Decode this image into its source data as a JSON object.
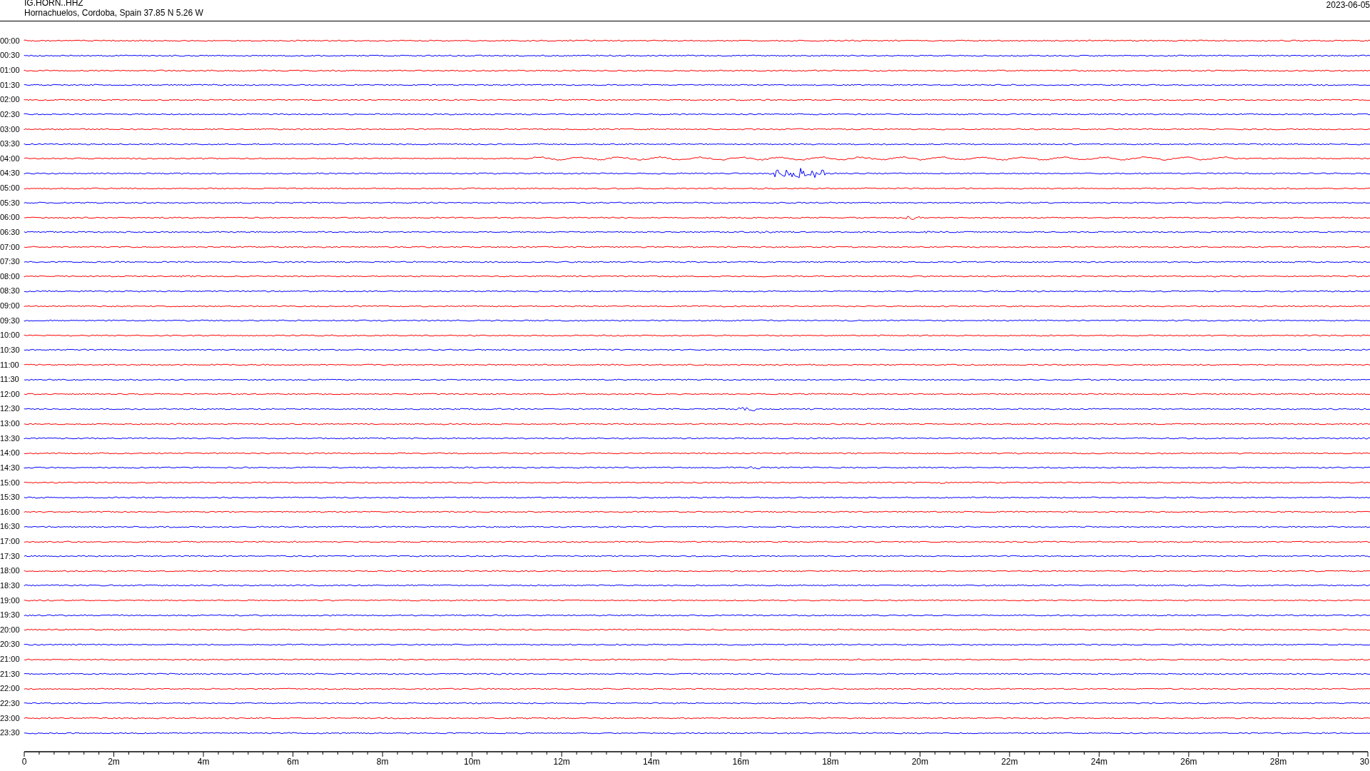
{
  "header": {
    "station": "IG.HORN..HHZ",
    "location": "Hornachuelos, Cordoba, Spain  37.85 N 5.26 W",
    "date": "2023-06-05"
  },
  "rows": [
    {
      "label": "00:00",
      "color": "#ff0000"
    },
    {
      "label": "00:30",
      "color": "#0000ff"
    },
    {
      "label": "01:00",
      "color": "#ff0000"
    },
    {
      "label": "01:30",
      "color": "#0000ff"
    },
    {
      "label": "02:00",
      "color": "#ff0000"
    },
    {
      "label": "02:30",
      "color": "#0000ff"
    },
    {
      "label": "03:00",
      "color": "#ff0000"
    },
    {
      "label": "03:30",
      "color": "#0000ff"
    },
    {
      "label": "04:00",
      "color": "#ff0000"
    },
    {
      "label": "04:30",
      "color": "#0000ff"
    },
    {
      "label": "05:00",
      "color": "#ff0000"
    },
    {
      "label": "05:30",
      "color": "#0000ff"
    },
    {
      "label": "06:00",
      "color": "#ff0000"
    },
    {
      "label": "06:30",
      "color": "#0000ff"
    },
    {
      "label": "07:00",
      "color": "#ff0000"
    },
    {
      "label": "07:30",
      "color": "#0000ff"
    },
    {
      "label": "08:00",
      "color": "#ff0000"
    },
    {
      "label": "08:30",
      "color": "#0000ff"
    },
    {
      "label": "09:00",
      "color": "#ff0000"
    },
    {
      "label": "09:30",
      "color": "#0000ff"
    },
    {
      "label": "10:00",
      "color": "#ff0000"
    },
    {
      "label": "10:30",
      "color": "#0000ff"
    },
    {
      "label": "11:00",
      "color": "#ff0000"
    },
    {
      "label": "11:30",
      "color": "#0000ff"
    },
    {
      "label": "12:00",
      "color": "#ff0000"
    },
    {
      "label": "12:30",
      "color": "#0000ff"
    },
    {
      "label": "13:00",
      "color": "#ff0000"
    },
    {
      "label": "13:30",
      "color": "#0000ff"
    },
    {
      "label": "14:00",
      "color": "#ff0000"
    },
    {
      "label": "14:30",
      "color": "#0000ff"
    },
    {
      "label": "15:00",
      "color": "#ff0000"
    },
    {
      "label": "15:30",
      "color": "#0000ff"
    },
    {
      "label": "16:00",
      "color": "#ff0000"
    },
    {
      "label": "16:30",
      "color": "#0000ff"
    },
    {
      "label": "17:00",
      "color": "#ff0000"
    },
    {
      "label": "17:30",
      "color": "#0000ff"
    },
    {
      "label": "18:00",
      "color": "#ff0000"
    },
    {
      "label": "18:30",
      "color": "#0000ff"
    },
    {
      "label": "19:00",
      "color": "#ff0000"
    },
    {
      "label": "19:30",
      "color": "#0000ff"
    },
    {
      "label": "20:00",
      "color": "#ff0000"
    },
    {
      "label": "20:30",
      "color": "#0000ff"
    },
    {
      "label": "21:00",
      "color": "#ff0000"
    },
    {
      "label": "21:30",
      "color": "#0000ff"
    },
    {
      "label": "22:00",
      "color": "#ff0000"
    },
    {
      "label": "22:30",
      "color": "#0000ff"
    },
    {
      "label": "23:00",
      "color": "#ff0000"
    },
    {
      "label": "23:30",
      "color": "#0000ff"
    }
  ],
  "time_axis": {
    "labels": [
      "0",
      "2m",
      "4m",
      "6m",
      "8m",
      "10m",
      "12m",
      "14m",
      "16m",
      "18m",
      "20m",
      "22m",
      "24m",
      "26m",
      "28m",
      "30"
    ]
  }
}
